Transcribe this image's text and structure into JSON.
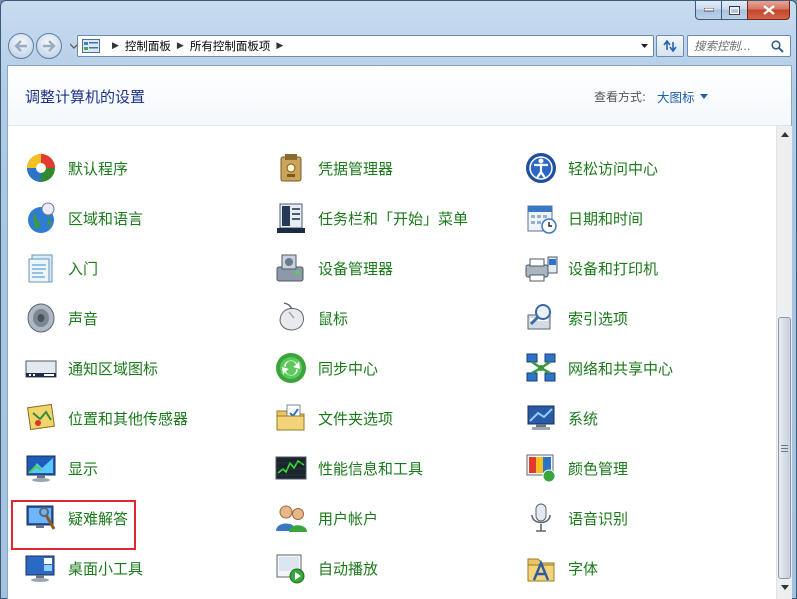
{
  "window": {
    "controls": {
      "minimize": "minimize-icon",
      "maximize": "maximize-icon",
      "close": "close-icon"
    }
  },
  "address_bar": {
    "crumbs": [
      "控制面板",
      "所有控制面板项"
    ],
    "search_placeholder": "搜索控制..."
  },
  "header": {
    "title": "调整计算机的设置",
    "view_label": "查看方式:",
    "view_value": "大图标"
  },
  "items": [
    {
      "label": "默认程序",
      "icon": "default-programs-icon"
    },
    {
      "label": "凭据管理器",
      "icon": "credential-manager-icon"
    },
    {
      "label": "轻松访问中心",
      "icon": "ease-of-access-icon"
    },
    {
      "label": "区域和语言",
      "icon": "region-language-icon"
    },
    {
      "label": "任务栏和「开始」菜单",
      "icon": "taskbar-start-menu-icon"
    },
    {
      "label": "日期和时间",
      "icon": "date-time-icon"
    },
    {
      "label": "入门",
      "icon": "getting-started-icon"
    },
    {
      "label": "设备管理器",
      "icon": "device-manager-icon"
    },
    {
      "label": "设备和打印机",
      "icon": "devices-printers-icon"
    },
    {
      "label": "声音",
      "icon": "sound-icon"
    },
    {
      "label": "鼠标",
      "icon": "mouse-icon"
    },
    {
      "label": "索引选项",
      "icon": "indexing-options-icon"
    },
    {
      "label": "通知区域图标",
      "icon": "notification-area-icon"
    },
    {
      "label": "同步中心",
      "icon": "sync-center-icon"
    },
    {
      "label": "网络和共享中心",
      "icon": "network-sharing-icon"
    },
    {
      "label": "位置和其他传感器",
      "icon": "location-sensors-icon"
    },
    {
      "label": "文件夹选项",
      "icon": "folder-options-icon"
    },
    {
      "label": "系统",
      "icon": "system-icon"
    },
    {
      "label": "显示",
      "icon": "display-icon"
    },
    {
      "label": "性能信息和工具",
      "icon": "performance-tools-icon"
    },
    {
      "label": "颜色管理",
      "icon": "color-management-icon"
    },
    {
      "label": "疑难解答",
      "icon": "troubleshooting-icon"
    },
    {
      "label": "用户帐户",
      "icon": "user-accounts-icon"
    },
    {
      "label": "语音识别",
      "icon": "speech-recognition-icon"
    },
    {
      "label": "桌面小工具",
      "icon": "desktop-gadgets-icon"
    },
    {
      "label": "自动播放",
      "icon": "autoplay-icon"
    },
    {
      "label": "字体",
      "icon": "fonts-icon"
    }
  ],
  "highlighted_item": "显示",
  "colors": {
    "item_label": "#1a7a1a",
    "title": "#1e3287",
    "highlight": "#e0282e"
  }
}
